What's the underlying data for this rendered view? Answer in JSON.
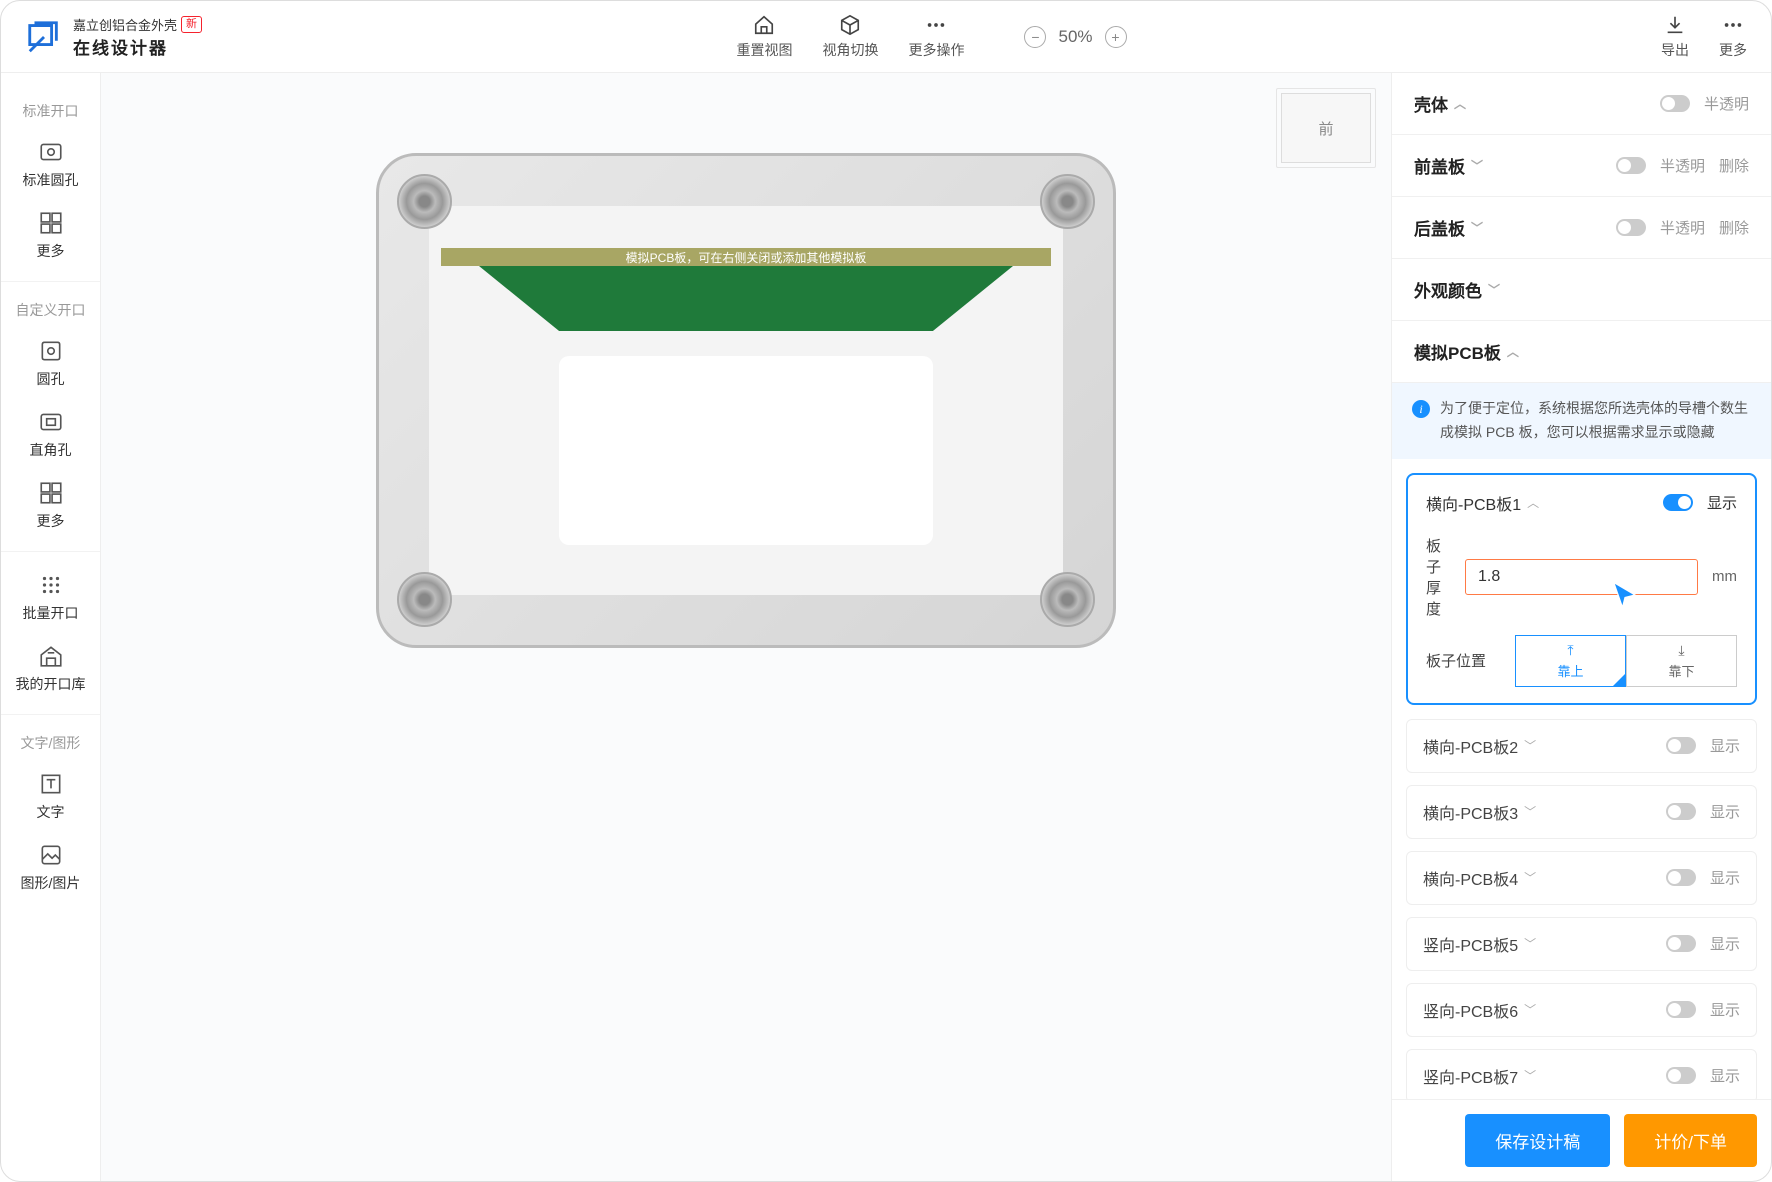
{
  "header": {
    "logo_line1": "嘉立创铝合金外壳",
    "logo_badge": "新",
    "logo_line2": "在线设计器",
    "center_buttons": [
      {
        "label": "重置视图"
      },
      {
        "label": "视角切换"
      },
      {
        "label": "更多操作"
      }
    ],
    "zoom": "50%",
    "right_buttons": [
      {
        "label": "导出"
      },
      {
        "label": "更多"
      }
    ]
  },
  "sidebar": {
    "sections": [
      {
        "heading": "标准开口",
        "items": [
          {
            "label": "标准圆孔"
          },
          {
            "label": "更多"
          }
        ]
      },
      {
        "heading": "自定义开口",
        "items": [
          {
            "label": "圆孔"
          },
          {
            "label": "直角孔"
          },
          {
            "label": "更多"
          }
        ]
      },
      {
        "heading": null,
        "items": [
          {
            "label": "批量开口"
          },
          {
            "label": "我的开口库"
          }
        ]
      },
      {
        "heading": "文字/图形",
        "items": [
          {
            "label": "文字"
          },
          {
            "label": "图形/图片"
          }
        ]
      }
    ]
  },
  "canvas": {
    "view_label": "前",
    "pcb_hint": "模拟PCB板，可在右侧关闭或添加其他模拟板"
  },
  "right_panel": {
    "rows": [
      {
        "title": "壳体",
        "actions": [
          "半透明"
        ]
      },
      {
        "title": "前盖板",
        "actions": [
          "半透明",
          "删除"
        ]
      },
      {
        "title": "后盖板",
        "actions": [
          "半透明",
          "删除"
        ]
      },
      {
        "title": "外观颜色",
        "actions": []
      }
    ],
    "pcb_section": {
      "title": "模拟PCB板",
      "info": "为了便于定位，系统根据您所选壳体的导槽个数生成模拟 PCB 板，您可以根据需求显示或隐藏",
      "active_card": {
        "title": "横向-PCB板1",
        "toggle_label": "显示",
        "thickness_label": "板子厚度",
        "thickness_value": "1.8",
        "thickness_unit": "mm",
        "position_label": "板子位置",
        "position_top": "靠上",
        "position_bottom": "靠下"
      },
      "list": [
        {
          "title": "横向-PCB板2",
          "label": "显示"
        },
        {
          "title": "横向-PCB板3",
          "label": "显示"
        },
        {
          "title": "横向-PCB板4",
          "label": "显示"
        },
        {
          "title": "竖向-PCB板5",
          "label": "显示"
        },
        {
          "title": "竖向-PCB板6",
          "label": "显示"
        },
        {
          "title": "竖向-PCB板7",
          "label": "显示"
        }
      ]
    },
    "footer": {
      "save": "保存设计稿",
      "order": "计价/下单"
    }
  }
}
